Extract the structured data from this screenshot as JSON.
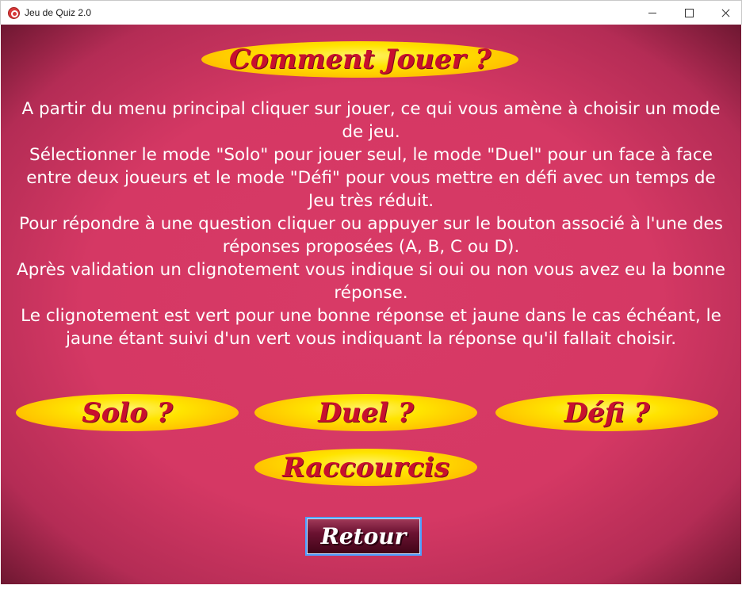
{
  "window": {
    "title": "Jeu de Quiz 2.0",
    "icon": "quiz-app-icon"
  },
  "page": {
    "heading": "Comment Jouer ?",
    "paragraphs": [
      "A partir du menu principal cliquer sur jouer, ce qui vous amène à choisir un mode de jeu.",
      "Sélectionner le mode \"Solo\" pour jouer seul, le mode \"Duel\" pour un face à face entre deux joueurs et le mode \"Défi\" pour vous mettre en défi avec un temps de Jeu très réduit.",
      "Pour répondre à une question cliquer ou appuyer sur le bouton associé à l'une des réponses proposées (A, B, C ou D).",
      "Après validation un clignotement vous indique si oui ou non vous avez eu la bonne réponse.",
      "Le clignotement est vert pour une bonne réponse et jaune dans le cas échéant, le jaune étant suivi d'un vert vous indiquant la réponse qu'il fallait choisir."
    ],
    "buttons": {
      "solo": "Solo ?",
      "duel": "Duel ?",
      "defi": "Défi ?",
      "raccourcis": "Raccourcis",
      "retour": "Retour"
    }
  },
  "colors": {
    "background": "#d53864",
    "oval_fill": "#ffe400",
    "oval_text": "#c8102e",
    "body_text": "#ffffff",
    "retour_border": "#4ea0ff"
  }
}
